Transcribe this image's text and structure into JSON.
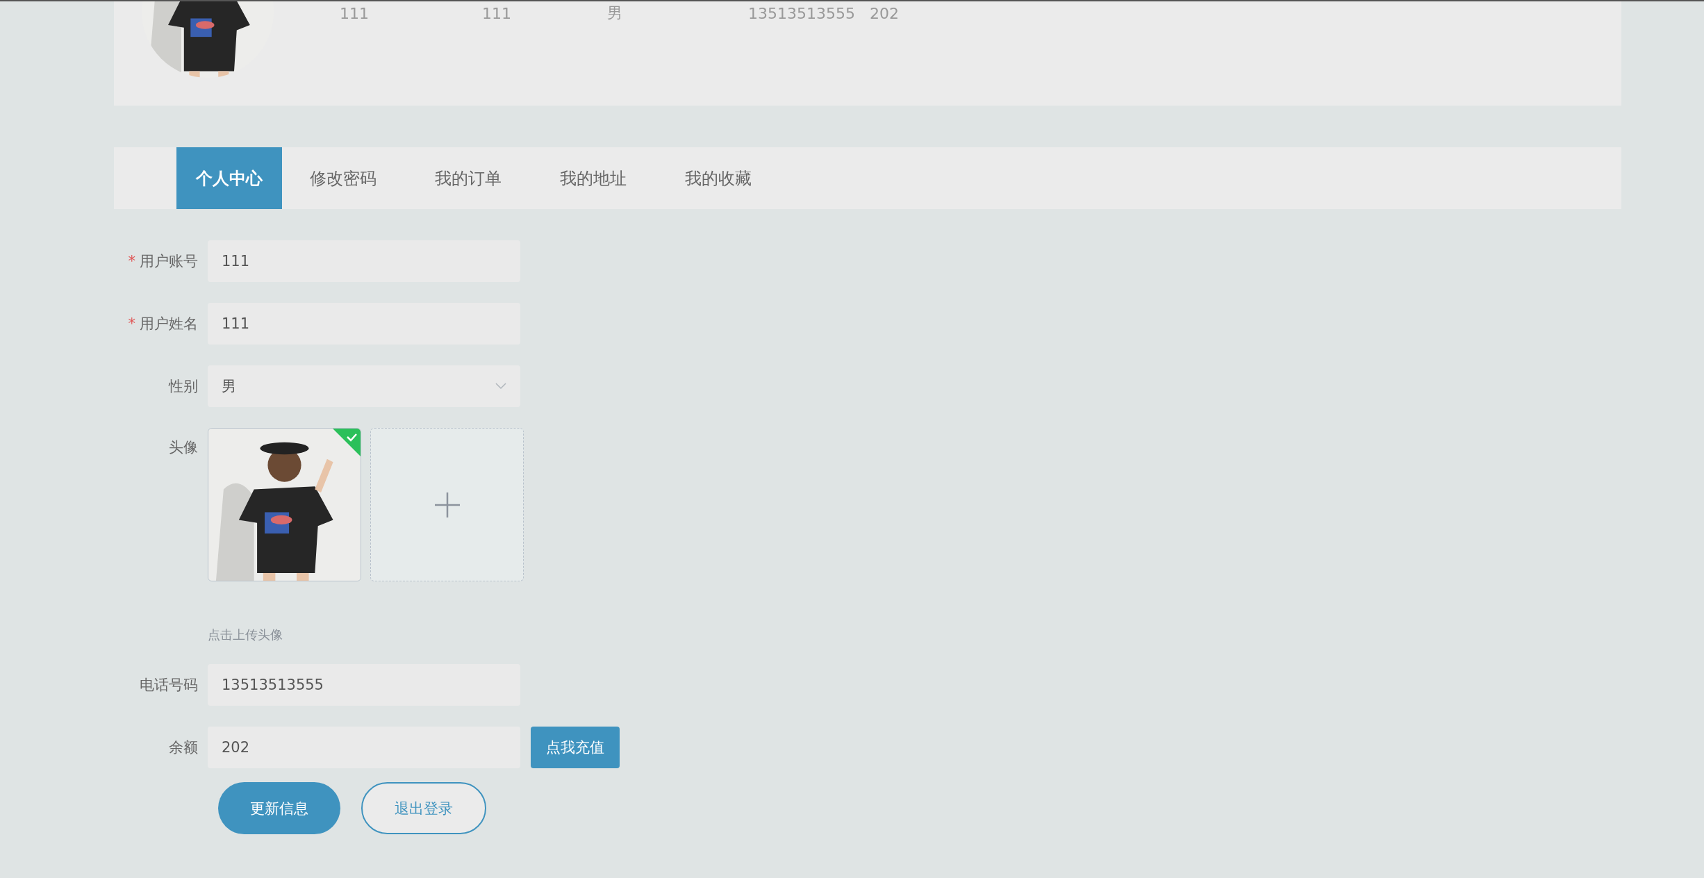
{
  "profile_summary": {
    "avatar": {
      "kind": "picture"
    },
    "values": [
      "111",
      "111",
      "男",
      "13513513555",
      "202"
    ]
  },
  "tabs": [
    {
      "label": "个人中心",
      "selected": true
    },
    {
      "label": "修改密码",
      "selected": false
    },
    {
      "label": "我的订单",
      "selected": false
    },
    {
      "label": "我的地址",
      "selected": false
    },
    {
      "label": "我的收藏",
      "selected": false
    }
  ],
  "form": {
    "fields": [
      {
        "kind": "input",
        "label": "用户账号",
        "required": true,
        "value": "111"
      },
      {
        "kind": "input",
        "label": "用户姓名",
        "required": true,
        "value": "111"
      },
      {
        "kind": "select",
        "label": "性别",
        "required": false,
        "value": "男"
      },
      {
        "kind": "upload",
        "label": "头像",
        "required": false,
        "uploaded": true,
        "hint": "点击上传头像"
      },
      {
        "kind": "input",
        "label": "电话号码",
        "required": false,
        "value": "13513513555"
      },
      {
        "kind": "input",
        "label": "余额",
        "required": false,
        "value": "202",
        "action": "点我充值"
      }
    ],
    "required_mark": "*",
    "buttons": [
      {
        "label": "更新信息",
        "kind": "primary"
      },
      {
        "label": "退出登录",
        "kind": "outline"
      }
    ]
  }
}
